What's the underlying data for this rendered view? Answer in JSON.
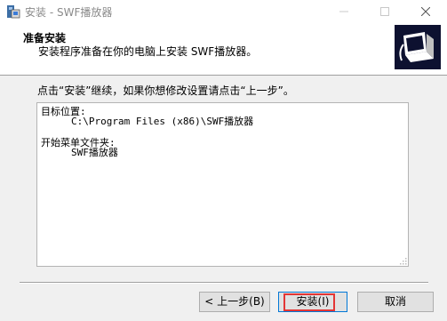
{
  "window": {
    "title": "安装 - SWF播放器",
    "minimize_icon": "minimize-icon",
    "maximize_icon": "maximize-icon",
    "close_icon": "close-icon"
  },
  "header": {
    "title": "准备安装",
    "subtitle": "安装程序准备在你的电脑上安装 SWF播放器。",
    "logo_icon": "setup-computer-icon"
  },
  "main": {
    "instruction": "点击“安装”继续，如果你想修改设置请点击“上一步”。",
    "memo": {
      "dest_label": "目标位置:",
      "dest_value": "C:\\Program Files (x86)\\SWF播放器",
      "group_label": "开始菜单文件夹:",
      "group_value": "SWF播放器"
    }
  },
  "buttons": {
    "back": "< 上一步(B)",
    "install": "安装(I)",
    "cancel": "取消"
  },
  "colors": {
    "focus_highlight": "#e33535",
    "default_button_border": "#0078d7"
  }
}
